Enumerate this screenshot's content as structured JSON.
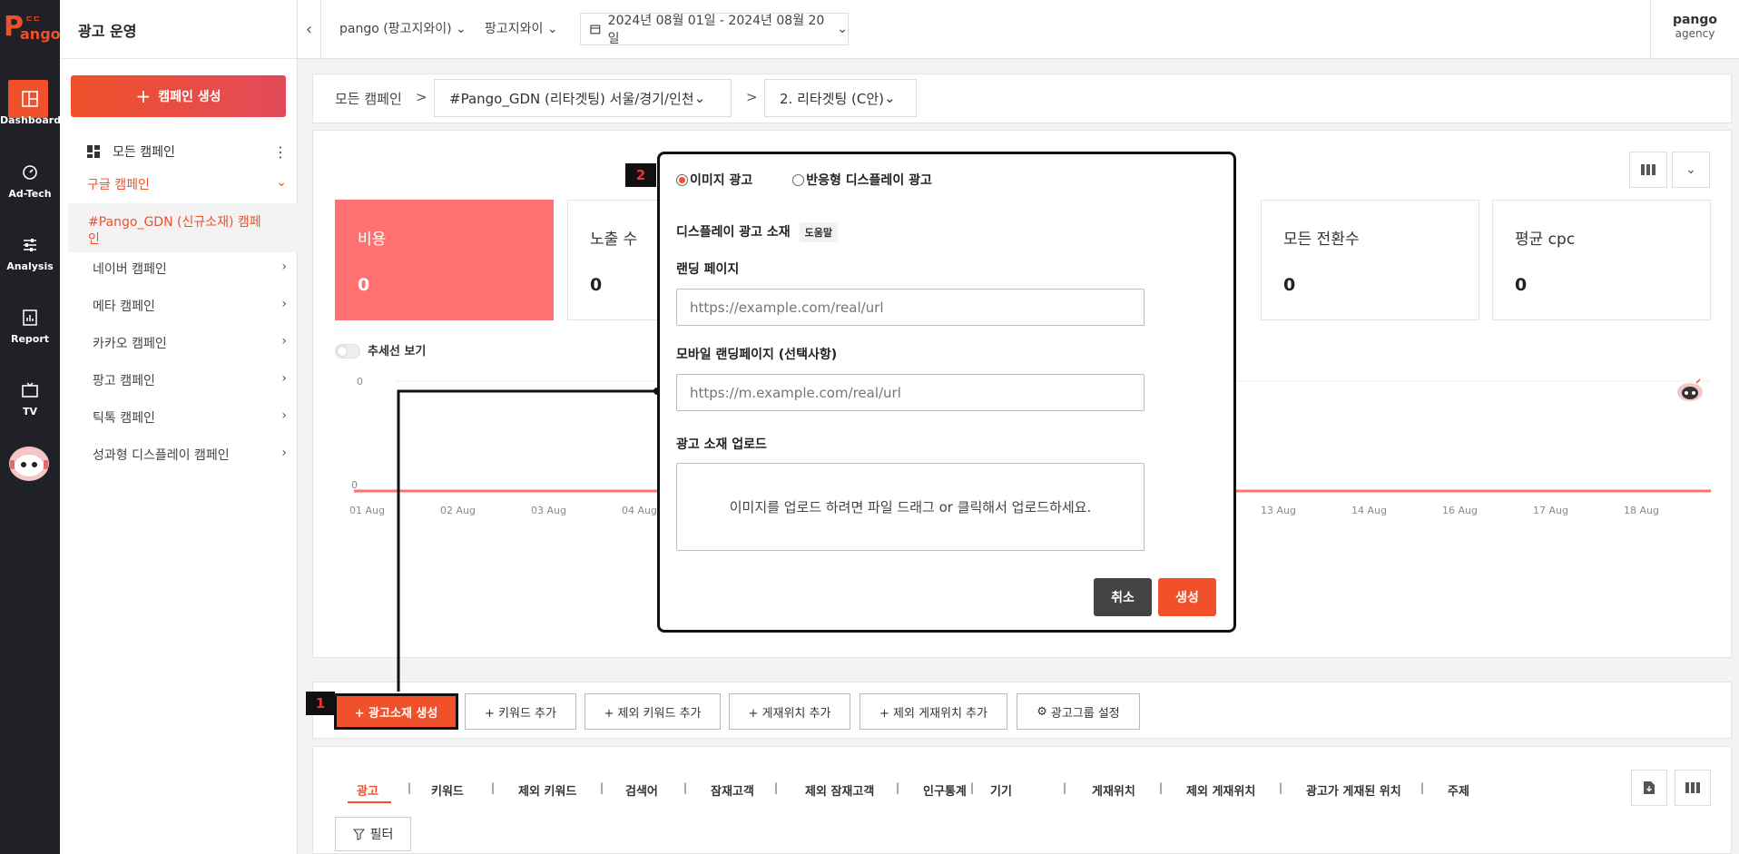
{
  "brand": {
    "logo_text": "ango",
    "logo_initial": "P",
    "logo_top": "ㄷㄷ",
    "accent": "#f0502a"
  },
  "rail": {
    "items": [
      {
        "label": "Dashboard",
        "icon": "dashboard-icon"
      },
      {
        "label": "Ad-Tech",
        "icon": "gauge-icon"
      },
      {
        "label": "Analysis",
        "icon": "sliders-icon"
      },
      {
        "label": "Report",
        "icon": "report-icon"
      },
      {
        "label": "TV",
        "icon": "tv-icon"
      }
    ]
  },
  "sidebar": {
    "title": "광고 운영",
    "create_label": "캠페인 생성",
    "all_campaigns": "모든 캠페인",
    "google": "구글 캠페인",
    "google_sub": "#Pango_GDN (신규소재) 캠페인",
    "items": [
      "네이버 캠페인",
      "메타 캠페인",
      "카카오 캠페인",
      "팡고 캠페인",
      "틱톡 캠페인",
      "성과형 디스플레이 캠페인"
    ]
  },
  "header": {
    "account": "pango (팡고지와이)",
    "advertiser": "팡고지와이",
    "date_range": "2024년 08월 01일 - 2024년 08월 20일",
    "user_name": "pango",
    "user_role": "agency"
  },
  "breadcrumb": {
    "root": "모든 캠페인",
    "sep": ">",
    "campaign": "#Pango_GDN (리타겟팅) 서울/경기/인천",
    "adgroup": "2. 리타겟팅 (C안)"
  },
  "kpis": [
    {
      "label": "비용",
      "value": "0"
    },
    {
      "label": "노출 수",
      "value": "0"
    },
    {
      "label": "모든 전환수",
      "value": "0"
    },
    {
      "label": "평균 cpc",
      "value": "0"
    }
  ],
  "trend_label": "추세선 보기",
  "chart_data": {
    "type": "line",
    "x": [
      "01 Aug",
      "02 Aug",
      "03 Aug",
      "04 Aug",
      "13 Aug",
      "14 Aug",
      "16 Aug",
      "17 Aug",
      "18 Aug"
    ],
    "y_top_tick": "0",
    "y_bottom_tick": "0",
    "series": [
      {
        "values": [
          0,
          0,
          0,
          0,
          0,
          0,
          0,
          0,
          0
        ]
      }
    ],
    "line_color": "#ff7170"
  },
  "actions": {
    "create_ad": "+ 광고소재 생성",
    "add_keyword": "+ 키워드 추가",
    "add_neg_keyword": "+ 제외 키워드 추가",
    "add_placement": "+ 게재위치 추가",
    "add_neg_placement": "+ 제외 게재위치 추가",
    "adgroup_settings": "광고그룹 설정"
  },
  "markers": {
    "one": "1",
    "two": "2"
  },
  "tabs": [
    "광고",
    "키워드",
    "제외 키워드",
    "검색어",
    "잠재고객",
    "제외 잠재고객",
    "인구통계",
    "기기",
    "게재위치",
    "제외 게재위치",
    "광고가 게재된 위치",
    "주제"
  ],
  "tab_sep": "|",
  "filter_label": "필터",
  "modal": {
    "radio_image": "이미지 광고",
    "radio_responsive": "반응형 디스플레이 광고",
    "section_title": "디스플레이 광고 소재",
    "help": "도움말",
    "landing_label": "랜딩 페이지",
    "landing_placeholder": "https://example.com/real/url",
    "mobile_label": "모바일 랜딩페이지 (선택사항)",
    "mobile_placeholder": "https://m.example.com/real/url",
    "upload_label": "광고 소재 업로드",
    "upload_hint": "이미지를 업로드 하려면 파일 드래그 or 클릭해서 업로드하세요.",
    "cancel": "취소",
    "create": "생성"
  }
}
